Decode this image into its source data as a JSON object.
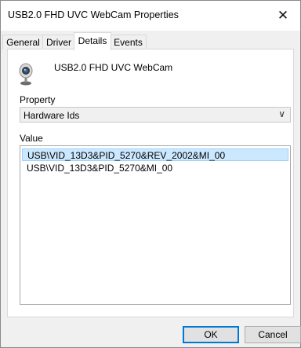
{
  "window": {
    "title": "USB2.0 FHD UVC WebCam Properties",
    "close_glyph": "✕"
  },
  "tabs": [
    {
      "label": "General"
    },
    {
      "label": "Driver"
    },
    {
      "label": "Details"
    },
    {
      "label": "Events"
    }
  ],
  "active_tab": "Details",
  "device": {
    "name": "USB2.0 FHD UVC WebCam",
    "icon": "webcam-icon"
  },
  "property": {
    "label": "Property",
    "selected": "Hardware Ids",
    "arrow": "∨"
  },
  "value": {
    "label": "Value",
    "items": [
      "USB\\VID_13D3&PID_5270&REV_2002&MI_00",
      "USB\\VID_13D3&PID_5270&MI_00"
    ]
  },
  "buttons": {
    "ok": "OK",
    "cancel": "Cancel"
  },
  "colors": {
    "selection": "#cce8ff",
    "accent": "#0078d7"
  }
}
